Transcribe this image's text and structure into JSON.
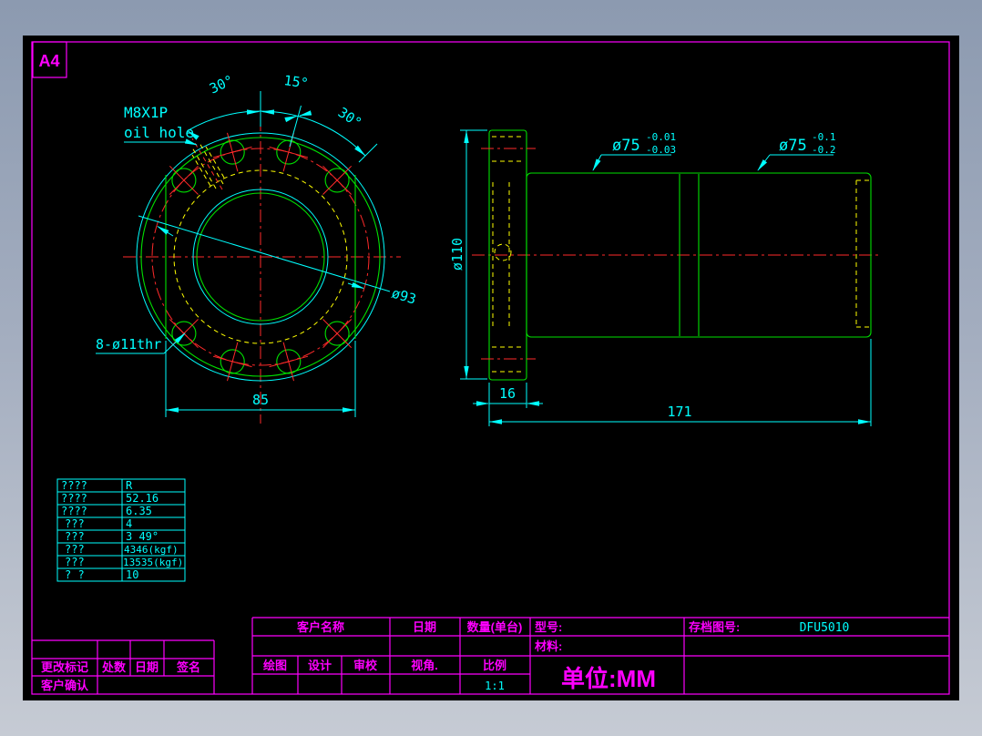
{
  "frame": {
    "size_label": "A4"
  },
  "front_view": {
    "oil_hole_spec": "M8X1P",
    "oil_hole_label": "oil hole",
    "bolt_pattern_label": "8-ø11thr",
    "bcd_dim": "ø93",
    "flats_width_dim": "85",
    "angle_dim_left": "30°",
    "angle_dim_mid": "15°",
    "angle_dim_right": "30°"
  },
  "side_view": {
    "flange_dia_dim": "ø110",
    "flange_thickness_dim": "16",
    "total_length_dim": "171",
    "journal_dia_dim": "ø75",
    "journal_tol_upper": "-0.01",
    "journal_tol_lower": "-0.03",
    "body_dia_dim": "ø75",
    "body_tol_upper": "-0.1",
    "body_tol_lower": "-0.2"
  },
  "spec_table": {
    "rows": [
      {
        "label": "????",
        "value": "R"
      },
      {
        "label": "????",
        "value": "52.16"
      },
      {
        "label": "????",
        "value": "6.35"
      },
      {
        "label": "???",
        "value": "4"
      },
      {
        "label": "???",
        "value": "3 49°"
      },
      {
        "label": "???",
        "value": "4346(kgf)"
      },
      {
        "label": "???",
        "value": "13535(kgf)"
      },
      {
        "label": "?  ?",
        "value": "10"
      }
    ]
  },
  "title_block": {
    "customer_name_label": "客户名称",
    "date_label": "日期",
    "qty_label": "数量(单台)",
    "model_label": "型号:",
    "archive_no_label": "存档图号:",
    "archive_no_value": "DFU5010",
    "material_label": "材料:",
    "draw_label": "绘图",
    "design_label": "设计",
    "check_label": "审校",
    "view_angle_label": "视角.",
    "scale_label": "比例",
    "scale_value": "1:1",
    "unit_text": "单位:MM",
    "change_mark_label": "更改标记",
    "change_count_label": "处数",
    "change_date_label": "日期",
    "sign_label": "签名",
    "customer_confirm_label": "客户确认"
  },
  "colors": {
    "geometry": "#00e100",
    "dimension": "#00ffff",
    "centerline": "#ff2a2a",
    "hidden": "#ffff00",
    "frame": "#ff00ff",
    "canvas": "#000000"
  }
}
